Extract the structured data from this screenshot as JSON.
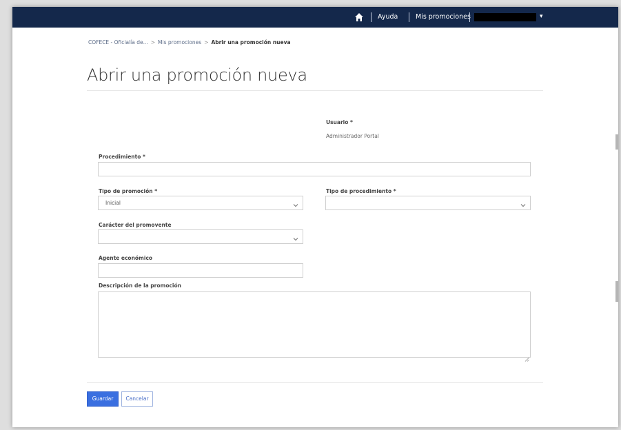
{
  "nav": {
    "home_icon": "home-icon",
    "help_label": "Ayuda",
    "my_promotions_label": "Mis promociones",
    "user_menu_caret": "▾",
    "bar_color": "#14284b"
  },
  "breadcrumb": {
    "items": [
      "COFECE - Oficialía de...",
      "Mis promociones",
      "Abrir una promoción nueva"
    ],
    "separator": ">"
  },
  "page": {
    "title": "Abrir una promoción nueva"
  },
  "form": {
    "user": {
      "label": "Usuario *",
      "value": "Administrador Portal"
    },
    "procedure": {
      "label": "Procedimiento *",
      "value": ""
    },
    "promotion_type": {
      "label": "Tipo de promoción *",
      "selected": "Inicial"
    },
    "procedure_type": {
      "label": "Tipo de procedimiento *",
      "selected": ""
    },
    "promoter_character": {
      "label": "Carácter del promovente",
      "selected": ""
    },
    "economic_agent": {
      "label": "Agente económico",
      "value": ""
    },
    "description": {
      "label": "Descripción de la promoción",
      "value": ""
    }
  },
  "actions": {
    "save_label": "Guardar",
    "cancel_label": "Cancelar",
    "primary_color": "#3a6fe0"
  }
}
